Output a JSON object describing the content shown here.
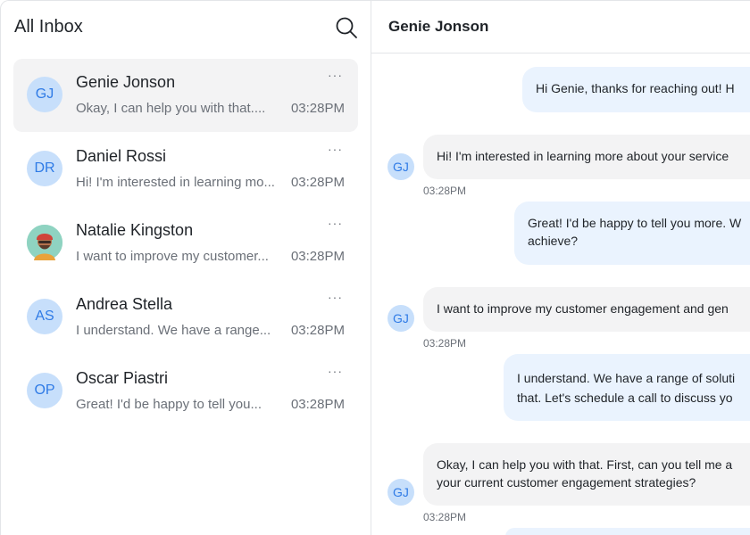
{
  "inbox": {
    "title": "All Inbox",
    "more_label": "···",
    "conversations": [
      {
        "initials": "GJ",
        "name": "Genie Jonson",
        "preview": "Okay, I can help you with that....",
        "time": "03:28PM"
      },
      {
        "initials": "DR",
        "name": "Daniel Rossi",
        "preview": "Hi! I'm interested in learning mo...",
        "time": "03:28PM"
      },
      {
        "initials": "",
        "name": "Natalie Kingston",
        "preview": "I want to improve my customer...",
        "time": "03:28PM"
      },
      {
        "initials": "AS",
        "name": "Andrea Stella",
        "preview": "I understand. We have a range...",
        "time": "03:28PM"
      },
      {
        "initials": "OP",
        "name": "Oscar Piastri",
        "preview": "Great! I'd be happy to tell you...",
        "time": "03:28PM"
      }
    ]
  },
  "chat": {
    "title": "Genie Jonson",
    "messages": [
      {
        "text": "Hi Genie, thanks for reaching out! H"
      },
      {
        "initials": "GJ",
        "text": "Hi! I'm interested in learning more about your service",
        "time": "03:28PM"
      },
      {
        "lines": [
          "Great! I'd be happy to tell you more. W",
          "achieve?"
        ]
      },
      {
        "initials": "GJ",
        "text": "I want to improve my customer engagement and gen",
        "time": "03:28PM"
      },
      {
        "lines": [
          "I understand. We have a range of soluti",
          "that. Let's schedule a call to discuss yo"
        ]
      },
      {
        "initials": "GJ",
        "lines": [
          "Okay, I can help you with that. First, can you tell me a",
          "your current customer engagement strategies?"
        ],
        "time": "03:28PM"
      }
    ]
  },
  "colors": {
    "accent": "#2f7be6",
    "avatar_bg": "#c7dffb",
    "outgoing_bubble": "#eaf3fe",
    "incoming_bubble": "#f3f3f4",
    "active_row": "#f3f3f4"
  }
}
